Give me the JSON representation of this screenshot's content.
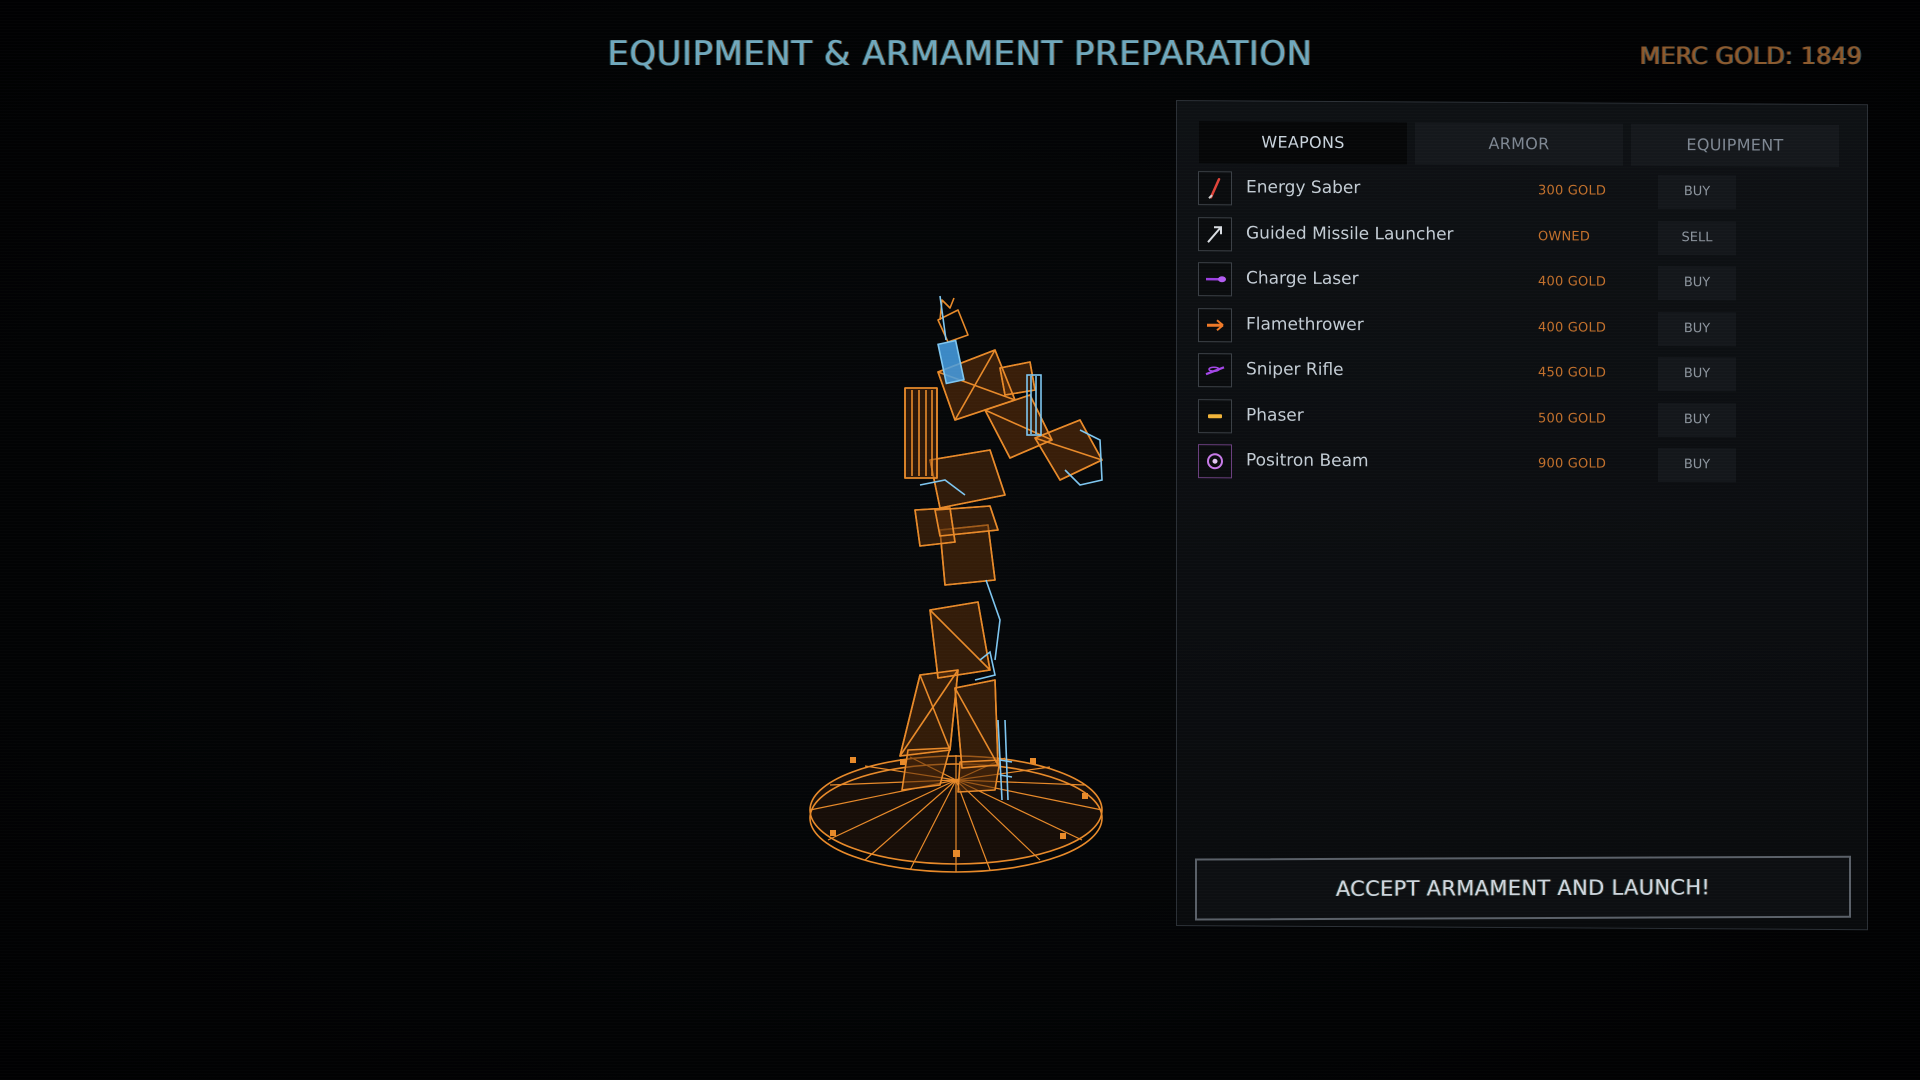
{
  "header": {
    "title": "EQUIPMENT & ARMAMENT PREPARATION",
    "gold_label": "MERC GOLD:",
    "gold_value": "1849"
  },
  "tabs": [
    {
      "label": "WEAPONS",
      "active": true
    },
    {
      "label": "ARMOR",
      "active": false
    },
    {
      "label": "EQUIPMENT",
      "active": false
    }
  ],
  "weapons": [
    {
      "name": "Energy Saber",
      "price": "300 GOLD",
      "action": "BUY",
      "icon": "saber-icon",
      "color": "#e0443a"
    },
    {
      "name": "Guided Missile Launcher",
      "price": "OWNED",
      "action": "SELL",
      "icon": "missile-launcher-icon",
      "color": "#d9dde2"
    },
    {
      "name": "Charge Laser",
      "price": "400 GOLD",
      "action": "BUY",
      "icon": "charge-laser-icon",
      "color": "#9b3fe0"
    },
    {
      "name": "Flamethrower",
      "price": "400 GOLD",
      "action": "BUY",
      "icon": "flamethrower-icon",
      "color": "#f07a28"
    },
    {
      "name": "Sniper Rifle",
      "price": "450 GOLD",
      "action": "BUY",
      "icon": "sniper-rifle-icon",
      "color": "#a447e8"
    },
    {
      "name": "Phaser",
      "price": "500 GOLD",
      "action": "BUY",
      "icon": "phaser-icon",
      "color": "#f2b53a"
    },
    {
      "name": "Positron Beam",
      "price": "900 GOLD",
      "action": "BUY",
      "icon": "positron-beam-icon",
      "color": "#c77ae8"
    }
  ],
  "launch_label": "ACCEPT ARMAMENT AND LAUNCH!",
  "colors": {
    "mech_wire": "#e88a2a",
    "mech_accent": "#7ec6f0",
    "price": "#c2702c",
    "title": "#6fa8bd"
  }
}
